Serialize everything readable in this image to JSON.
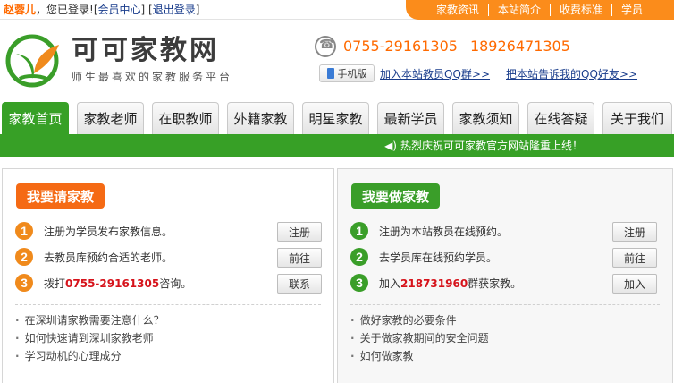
{
  "topbar": {
    "username": "赵蓉儿",
    "logged_in_text": "，您已登录!",
    "member_center": "会员中心",
    "logout": "退出登录",
    "links": [
      "家教资讯",
      "本站简介",
      "收费标准",
      "学员"
    ]
  },
  "header": {
    "logo_text": "可可家教网",
    "slogan": "师生最喜欢的家教服务平台",
    "phone1": "0755-29161305",
    "phone2": "18926471305",
    "mobile_label": "手机版",
    "join_qq_group": "加入本站教员QQ群>>",
    "tell_qq_friends": "把本站告诉我的QQ好友>>"
  },
  "nav": {
    "tabs": [
      "家教首页",
      "家教老师",
      "在职教师",
      "外籍家教",
      "明星家教",
      "最新学员",
      "家教须知",
      "在线答疑",
      "关于我们"
    ],
    "active_index": 0,
    "announcement": "热烈庆祝可可家教官方网站隆重上线！"
  },
  "left_panel": {
    "title": "我要请家教",
    "steps": [
      {
        "num": "1",
        "text": "注册为学员发布家教信息。",
        "button": "注册"
      },
      {
        "num": "2",
        "text": "去教员库预约合适的老师。",
        "button": "前往"
      },
      {
        "num": "3",
        "text_before": "拨打",
        "highlight": "0755-29161305",
        "text_after": "咨询。",
        "button": "联系"
      }
    ],
    "tips": [
      "在深圳请家教需要注意什么？",
      "如何快速请到深圳家教老师",
      "学习动机的心理成分"
    ]
  },
  "right_panel": {
    "title": "我要做家教",
    "steps": [
      {
        "num": "1",
        "text": "注册为本站教员在线预约。",
        "button": "注册"
      },
      {
        "num": "2",
        "text": "去学员库在线预约学员。",
        "button": "前往"
      },
      {
        "num": "3",
        "text_before": "加入",
        "highlight": "218731960",
        "text_after": "群获家教。",
        "button": "加入"
      }
    ],
    "tips": [
      "做好家教的必要条件",
      "关于做家教期间的安全问题",
      "如何做家教"
    ]
  },
  "colors": {
    "accent_orange": "#fb8c1b",
    "nav_green": "#37a026",
    "highlight_red": "#d6131b",
    "link_blue": "#1a3d8c"
  }
}
